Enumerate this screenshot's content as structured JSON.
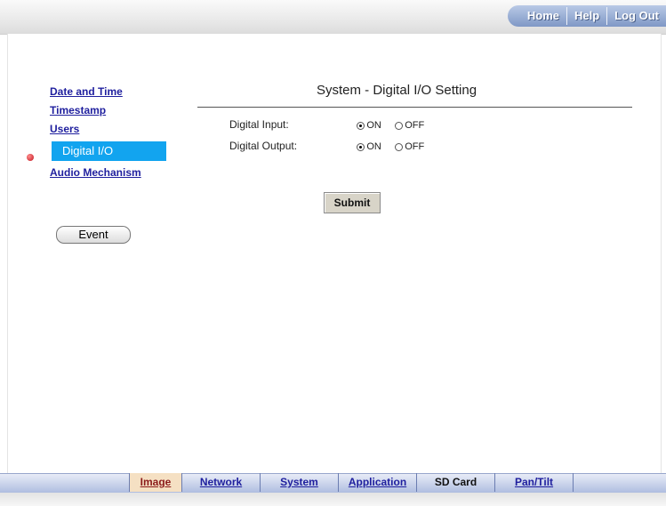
{
  "top_nav": {
    "home": "Home",
    "help": "Help",
    "logout": "Log Out"
  },
  "sidebar": {
    "items": [
      {
        "label": "Date and Time"
      },
      {
        "label": "Timestamp"
      },
      {
        "label": "Users"
      },
      {
        "label": "Digital I/O"
      },
      {
        "label": "Audio Mechanism"
      }
    ],
    "event_button": "Event"
  },
  "main": {
    "title": "System - Digital I/O Setting",
    "digital_input": {
      "label": "Digital Input:",
      "on": "ON",
      "off": "OFF",
      "selected": "ON"
    },
    "digital_output": {
      "label": "Digital Output:",
      "on": "ON",
      "off": "OFF",
      "selected": "ON"
    },
    "submit": "Submit"
  },
  "bottom_tabs": [
    "Image",
    "Network",
    "System",
    "Application",
    "SD Card",
    "Pan/Tilt"
  ]
}
